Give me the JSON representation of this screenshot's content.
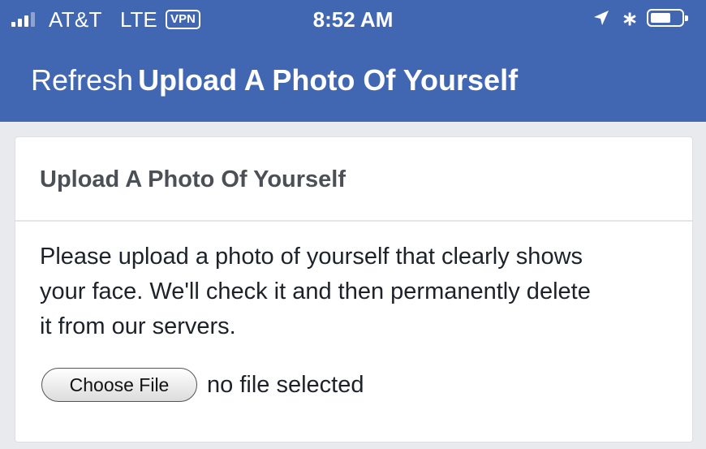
{
  "status_bar": {
    "carrier": "AT&T",
    "network": "LTE",
    "vpn_badge": "VPN",
    "time": "8:52 AM",
    "icons": [
      "signal-bars-icon",
      "location-arrow-icon",
      "bluetooth-icon",
      "battery-icon"
    ],
    "signal_strength": 3,
    "signal_max": 4,
    "battery_level": 0.55
  },
  "nav": {
    "refresh_label": "Refresh",
    "title": "Upload A Photo Of Yourself",
    "background_color": "#4267b2"
  },
  "card": {
    "header": "Upload A Photo Of Yourself",
    "description": "Please upload a photo of yourself that clearly shows your face. We'll check it and then permanently delete it from our servers.",
    "choose_file_label": "Choose File",
    "file_status": "no file selected"
  }
}
